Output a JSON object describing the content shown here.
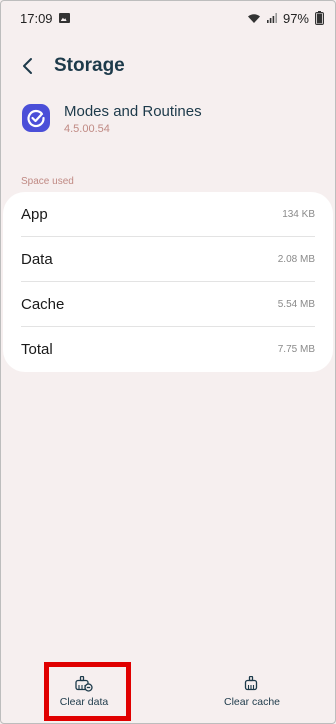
{
  "status_bar": {
    "time": "17:09",
    "battery": "97%",
    "icons": [
      "gallery-icon",
      "wifi-icon",
      "signal-icon",
      "battery-icon"
    ]
  },
  "header": {
    "title": "Storage",
    "back_icon": "chevron-left-icon"
  },
  "app": {
    "name": "Modes and Routines",
    "version": "4.5.00.54",
    "icon": "check-circle-icon",
    "icon_color": "#4b4fd8"
  },
  "section": {
    "label": "Space used"
  },
  "storage": {
    "rows": [
      {
        "label": "App",
        "value": "134 KB"
      },
      {
        "label": "Data",
        "value": "2.08 MB"
      },
      {
        "label": "Cache",
        "value": "5.54 MB"
      },
      {
        "label": "Total",
        "value": "7.75 MB"
      }
    ]
  },
  "actions": {
    "clear_data": "Clear data",
    "clear_cache": "Clear cache"
  },
  "colors": {
    "background": "#f6efef",
    "title": "#1d3a4a",
    "accent_label": "#c08a84",
    "highlight": "#e00000"
  }
}
